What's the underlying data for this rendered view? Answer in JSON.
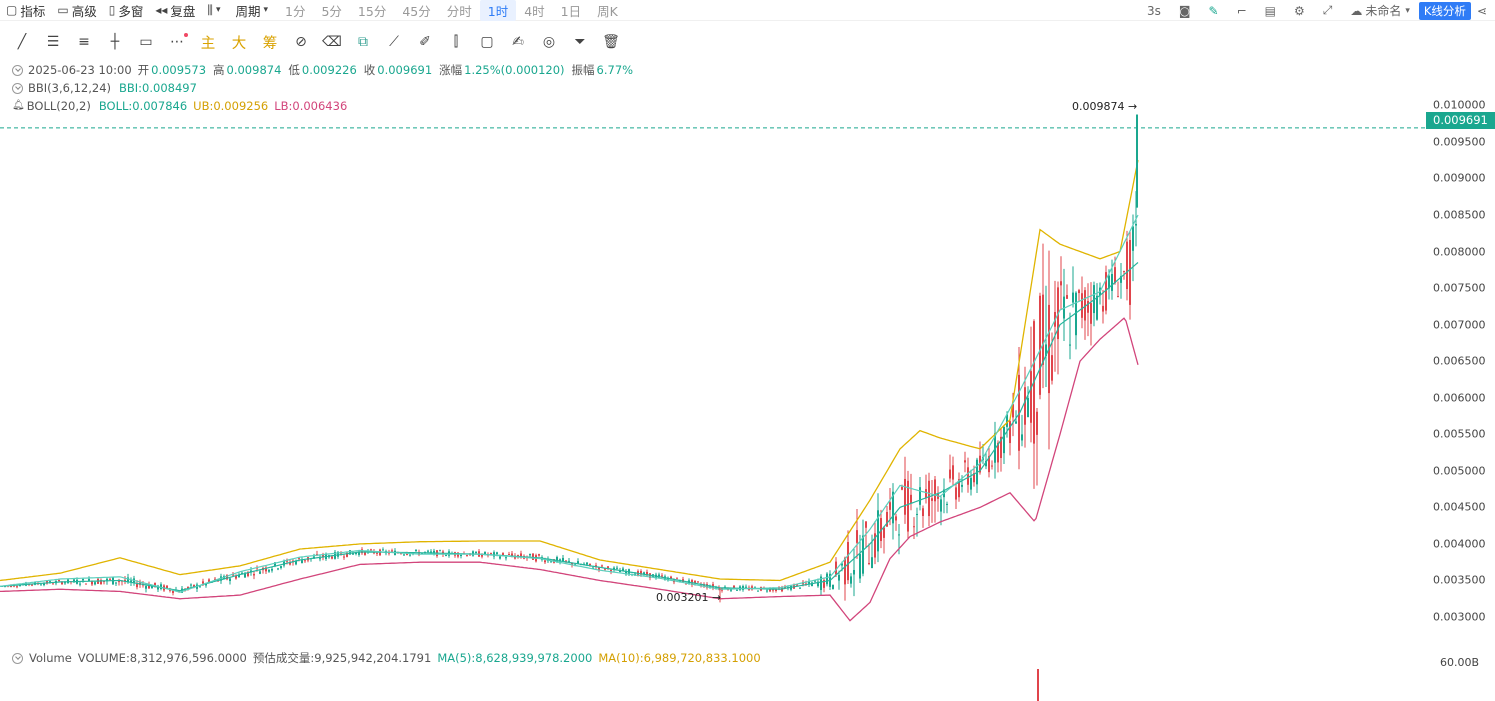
{
  "toolbar": {
    "indicator": "指标",
    "advanced": "高级",
    "multi_window": "多窗",
    "replay": "复盘",
    "period": "周期",
    "periods": [
      "1分",
      "5分",
      "15分",
      "45分",
      "分时",
      "1时",
      "4时",
      "1日",
      "周K"
    ],
    "active_period": "1时",
    "refresh": "3s",
    "layout_name": "未命名",
    "kline_analysis": "K线分析"
  },
  "draw_tools": {
    "main": "主",
    "big": "大",
    "chip": "筹"
  },
  "legend": {
    "date": "2025-06-23 10:00",
    "open_label": "开",
    "open": "0.009573",
    "high_label": "高",
    "high": "0.009874",
    "low_label": "低",
    "low": "0.009226",
    "close_label": "收",
    "close": "0.009691",
    "change_label": "涨幅",
    "change": "1.25%(0.000120)",
    "amp_label": "振幅",
    "amp": "6.77%",
    "bbi_name": "BBI(3,6,12,24)",
    "bbi_value": "BBI:0.008497",
    "boll_name": "BOLL(20,2)",
    "boll_value": "BOLL:0.007846",
    "ub_value": "UB:0.009256",
    "lb_value": "LB:0.006436"
  },
  "price_axis": {
    "ticks": [
      "0.010000",
      "0.009500",
      "0.009000",
      "0.008500",
      "0.008000",
      "0.007500",
      "0.007000",
      "0.006500",
      "0.006000",
      "0.005500",
      "0.005000",
      "0.004500",
      "0.004000",
      "0.003500",
      "0.003000"
    ],
    "current_price": "0.009691"
  },
  "annotations": {
    "high": "0.009874",
    "low": "0.003201"
  },
  "volume": {
    "name": "Volume",
    "volume": "VOLUME:8,312,976,596.0000",
    "estimate": "预估成交量:9,925,942,204.1791",
    "ma5": "MA(5):8,628,939,978.2000",
    "ma10": "MA(10):6,989,720,833.1000",
    "axis_label": "60.00B"
  },
  "colors": {
    "up": "#1aa78f",
    "down": "#e0444b",
    "ub": "#e0b400",
    "lb": "#d2457b",
    "mid": "#26b59d",
    "bbi": "#5ccfbd",
    "accent": "#2f7cf6"
  },
  "chart_data": {
    "type": "line",
    "series": [
      {
        "name": "BBI(3,6,12,24)",
        "x": [
          0,
          60,
          120,
          180,
          240,
          300,
          360,
          420,
          480,
          540,
          600,
          660,
          720,
          780,
          830,
          870,
          900,
          940,
          980,
          1020,
          1060,
          1100,
          1138
        ],
        "values": [
          0.00342,
          0.00352,
          0.00355,
          0.00334,
          0.00362,
          0.00382,
          0.00391,
          0.00386,
          0.00386,
          0.0038,
          0.00364,
          0.00353,
          0.00338,
          0.0034,
          0.00355,
          0.0042,
          0.0048,
          0.00465,
          0.0051,
          0.0061,
          0.0072,
          0.00745,
          0.0085
        ]
      },
      {
        "name": "BOLL",
        "x": [
          0,
          60,
          120,
          180,
          240,
          300,
          360,
          420,
          480,
          540,
          600,
          660,
          720,
          780,
          830,
          870,
          900,
          940,
          980,
          1020,
          1060,
          1100,
          1138
        ],
        "values": [
          0.00342,
          0.00348,
          0.0035,
          0.00336,
          0.00358,
          0.00378,
          0.00389,
          0.00388,
          0.00386,
          0.00381,
          0.00368,
          0.00355,
          0.0034,
          0.00338,
          0.0035,
          0.004,
          0.0045,
          0.0047,
          0.005,
          0.0058,
          0.007,
          0.0074,
          0.00785
        ]
      },
      {
        "name": "UB",
        "x": [
          0,
          60,
          120,
          180,
          240,
          300,
          360,
          420,
          480,
          540,
          600,
          660,
          720,
          780,
          830,
          870,
          900,
          920,
          940,
          980,
          1010,
          1040,
          1060,
          1080,
          1100,
          1120,
          1138
        ],
        "values": [
          0.0035,
          0.0036,
          0.00381,
          0.00358,
          0.0037,
          0.00393,
          0.004,
          0.00403,
          0.00404,
          0.00404,
          0.00378,
          0.00365,
          0.00352,
          0.0035,
          0.00375,
          0.0046,
          0.0053,
          0.00555,
          0.00545,
          0.0053,
          0.0057,
          0.0083,
          0.0081,
          0.008,
          0.0079,
          0.008,
          0.00925
        ]
      },
      {
        "name": "LB",
        "x": [
          0,
          60,
          120,
          180,
          240,
          300,
          360,
          420,
          480,
          540,
          600,
          660,
          720,
          780,
          830,
          850,
          870,
          890,
          910,
          940,
          980,
          1010,
          1035,
          1060,
          1080,
          1100,
          1125,
          1138
        ],
        "values": [
          0.00335,
          0.00338,
          0.00335,
          0.00325,
          0.0033,
          0.00352,
          0.00372,
          0.00375,
          0.00375,
          0.00365,
          0.0035,
          0.00338,
          0.00325,
          0.00328,
          0.0033,
          0.00295,
          0.0032,
          0.0038,
          0.0041,
          0.0043,
          0.0045,
          0.0047,
          0.0043,
          0.0055,
          0.0065,
          0.0068,
          0.0071,
          0.00645
        ]
      }
    ],
    "ylim": [
      0.00285,
      0.0101
    ],
    "last_close": 0.009691,
    "high_mark": 0.009874,
    "low_mark": 0.003201
  }
}
